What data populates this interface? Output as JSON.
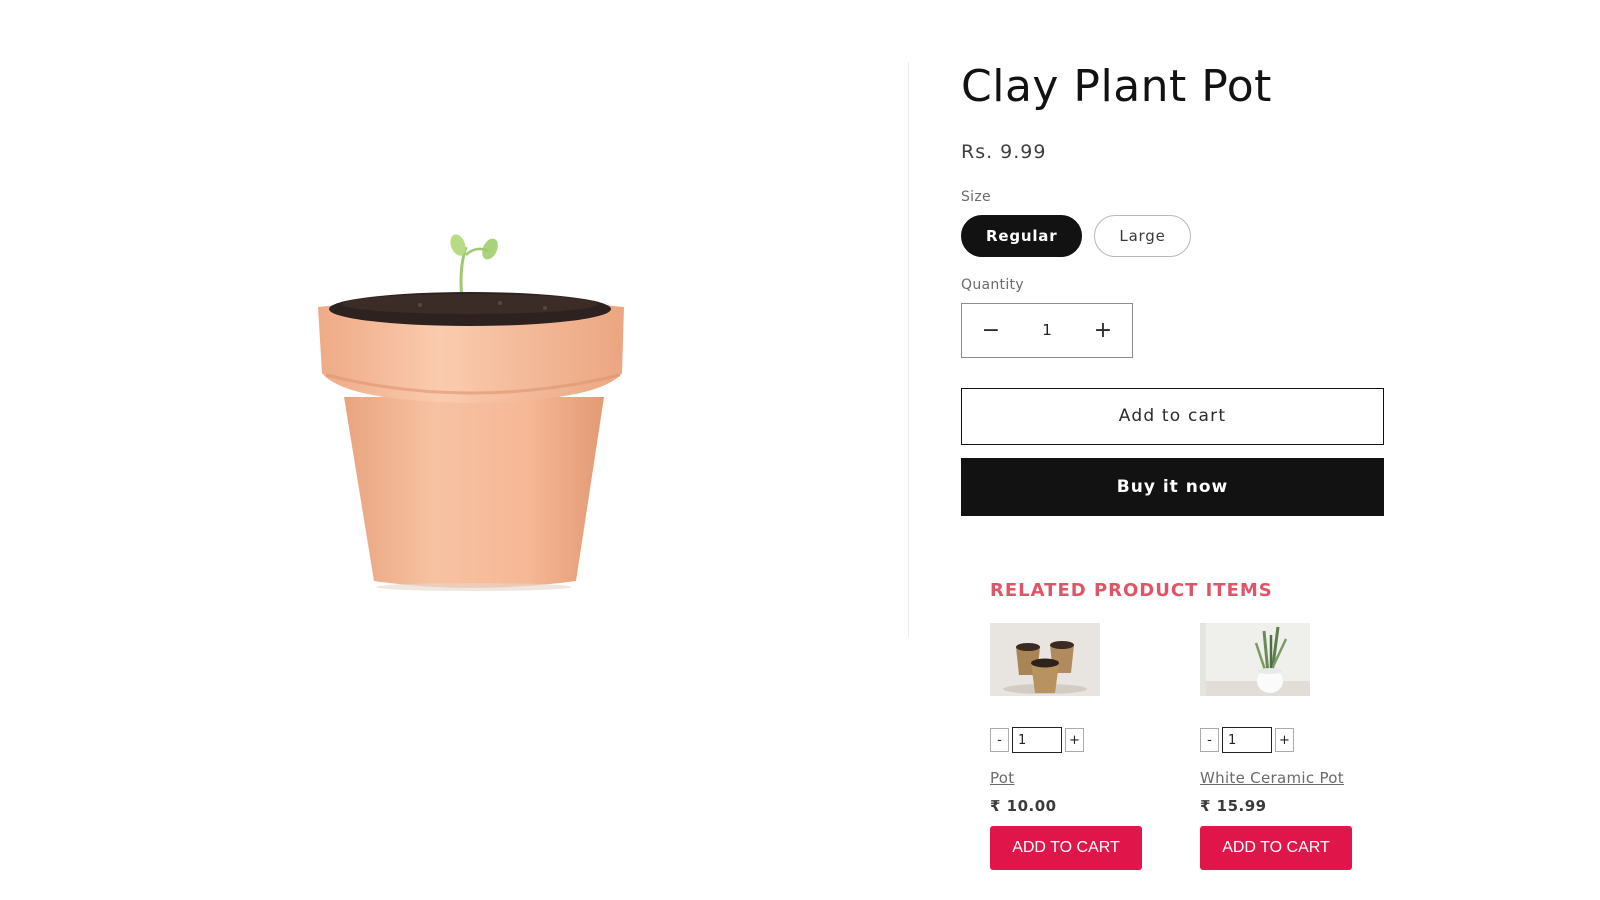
{
  "product": {
    "title": "Clay Plant Pot",
    "price": "Rs. 9.99",
    "size_label": "Size",
    "sizes": [
      {
        "label": "Regular",
        "selected": true
      },
      {
        "label": "Large",
        "selected": false
      }
    ],
    "quantity_label": "Quantity",
    "quantity": "1",
    "decrease_symbol": "−",
    "increase_symbol": "+",
    "add_to_cart_label": "Add to cart",
    "buy_now_label": "Buy it now",
    "image_icon": "terracotta-pot-with-seedling"
  },
  "related": {
    "heading": "RELATED PRODUCT ITEMS",
    "items": [
      {
        "name": "Pot",
        "price": "₹ 10.00",
        "quantity": "1",
        "minus": "-",
        "plus": "+",
        "button_label": "ADD TO CART",
        "image_icon": "three-small-pots"
      },
      {
        "name": "White Ceramic Pot",
        "price": "₹ 15.99",
        "quantity": "1",
        "minus": "-",
        "plus": "+",
        "button_label": "ADD TO CART",
        "image_icon": "white-pot-with-snake-plant"
      }
    ]
  },
  "colors": {
    "primary_dark": "#121212",
    "related_heading": "#e15466",
    "cart_button": "#e0164b",
    "terracotta": "#f4b594"
  }
}
